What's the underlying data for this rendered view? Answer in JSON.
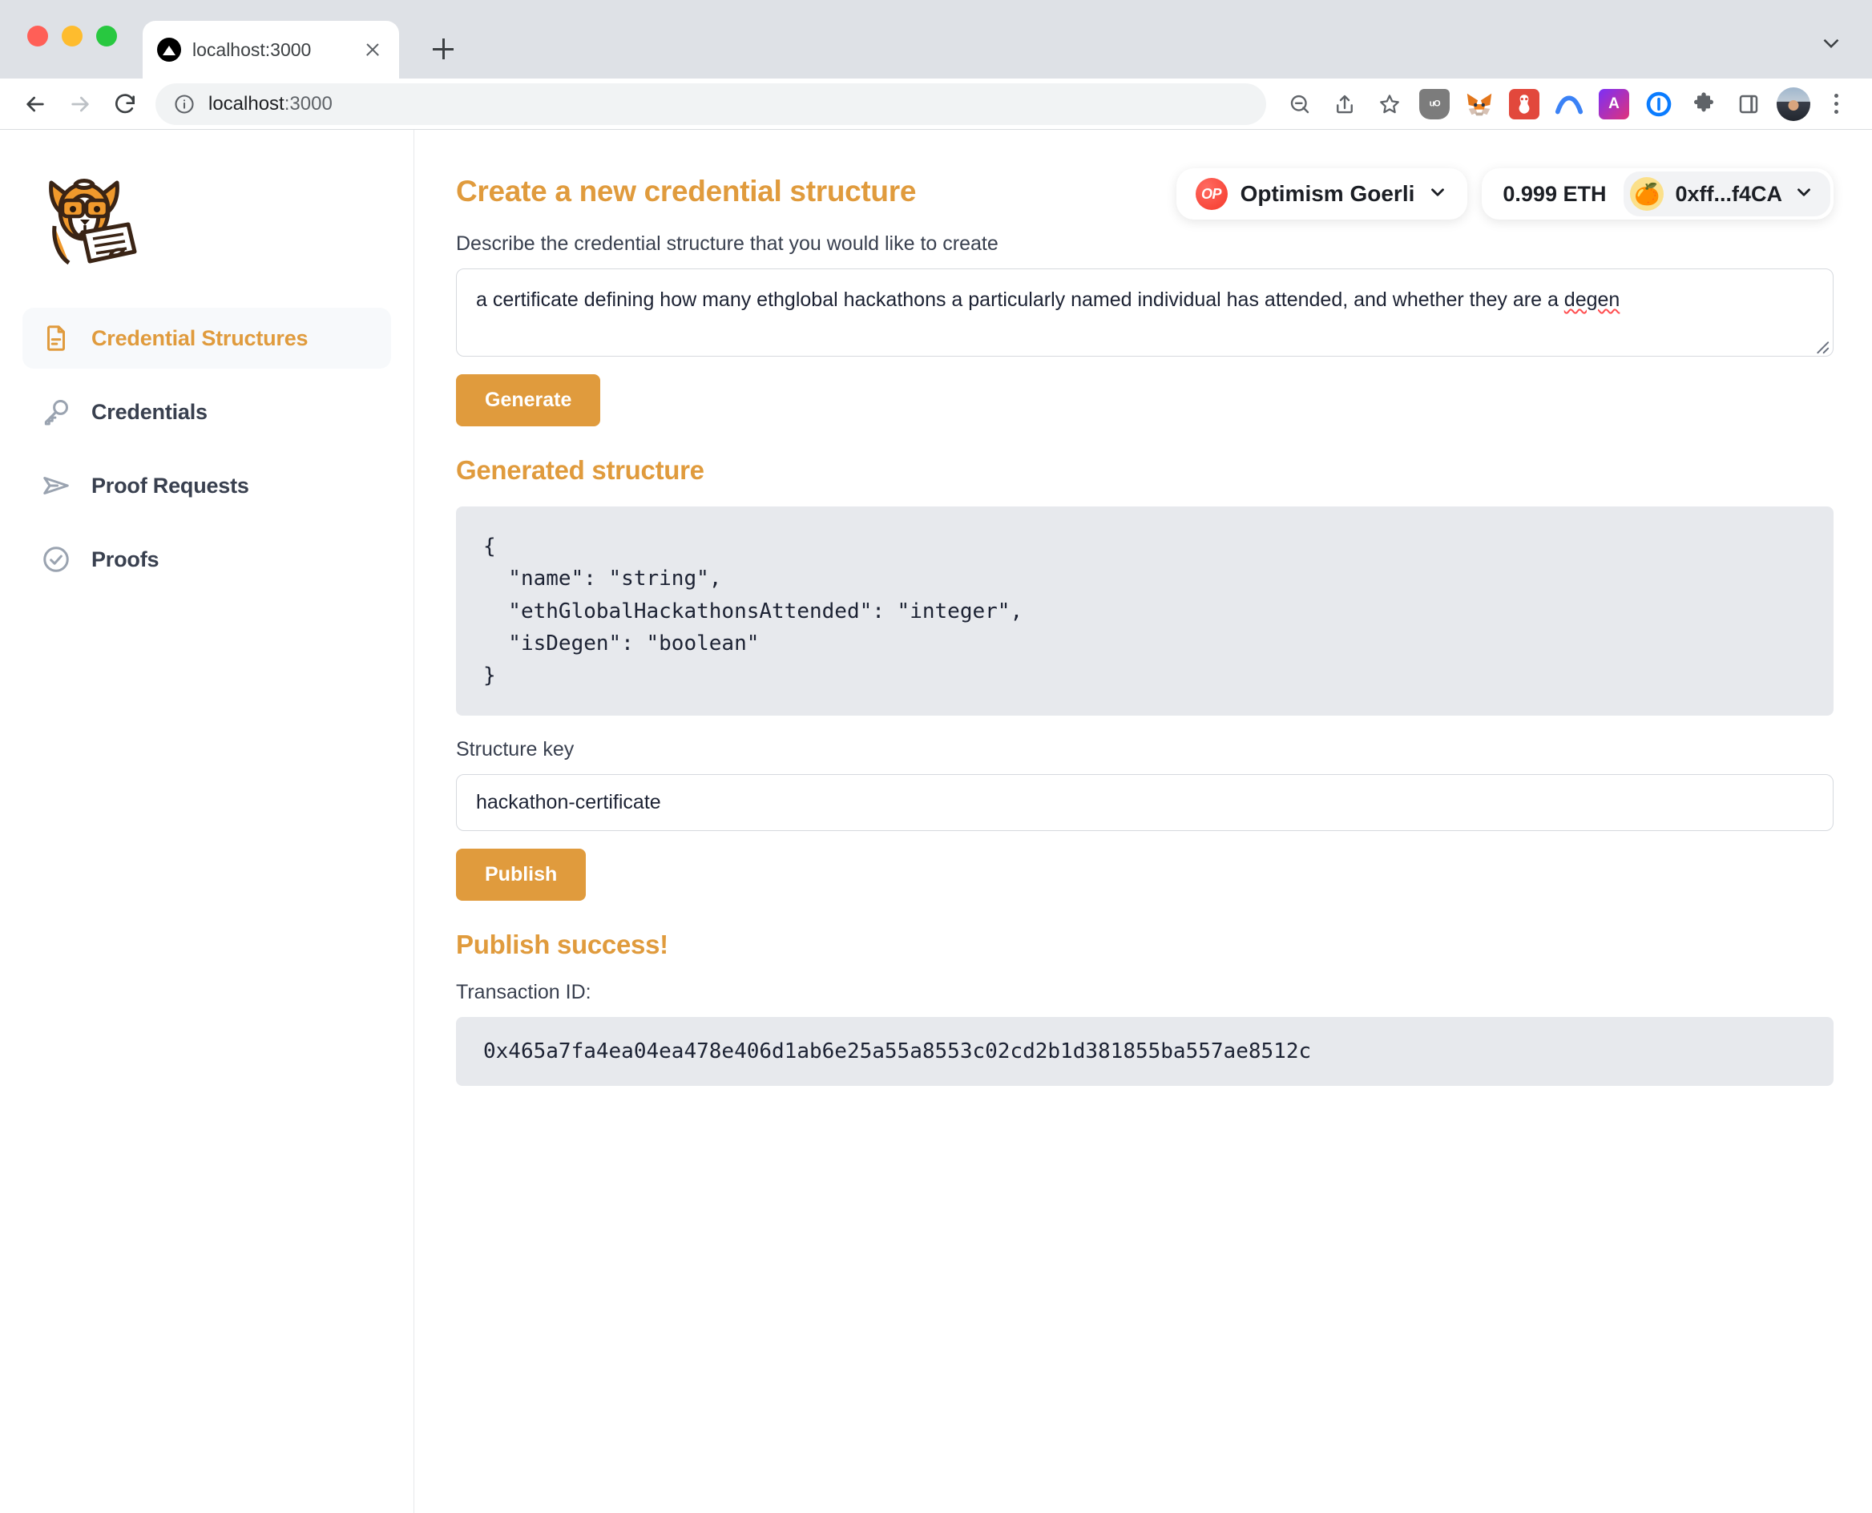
{
  "browser": {
    "tab": {
      "title": "localhost:3000",
      "favicon": "vercel-triangle-icon"
    },
    "omnibox": {
      "host": "localhost",
      "port": ":3000",
      "info_icon": "info-circle-icon"
    },
    "nav": {
      "back": "back-arrow-icon",
      "forward": "forward-arrow-icon",
      "reload": "reload-icon"
    },
    "actions": {
      "zoom_out": "zoom-out-icon",
      "share": "share-icon",
      "bookmark": "star-icon",
      "extensions": "puzzle-icon",
      "side_panel": "side-panel-icon",
      "menu": "kebab-menu-icon"
    },
    "extensions": [
      {
        "name": "ublock-origin-extension-icon",
        "label": "uO"
      },
      {
        "name": "metamask-extension-icon",
        "label": ""
      },
      {
        "name": "rabby-wallet-extension-icon",
        "label": ""
      },
      {
        "name": "arc-extension-icon",
        "label": ""
      },
      {
        "name": "a-extension-icon",
        "label": "A"
      },
      {
        "name": "onepassword-extension-icon",
        "label": ""
      }
    ]
  },
  "sidebar": {
    "logo_alt": "corgi-reading-document-logo",
    "items": [
      {
        "label": "Credential Structures",
        "icon": "document-icon",
        "active": true
      },
      {
        "label": "Credentials",
        "icon": "key-icon",
        "active": false
      },
      {
        "label": "Proof Requests",
        "icon": "paper-plane-icon",
        "active": false
      },
      {
        "label": "Proofs",
        "icon": "check-circle-icon",
        "active": false
      }
    ]
  },
  "wallet": {
    "chain": {
      "badge": "OP",
      "name": "Optimism Goerli",
      "chevron": "chevron-down-icon"
    },
    "balance": "0.999 ETH",
    "address": "0xff...f4CA",
    "avatar": "🍊",
    "chevron": "chevron-down-icon"
  },
  "main": {
    "page_title": "Create a new credential structure",
    "describe_label": "Describe the credential structure that you would like to create",
    "description_value_pre": "a certificate defining how many ethglobal hackathons a particularly named individual has attended, and whether they are a ",
    "description_value_misspelled": "degen",
    "description_placeholder": "",
    "generate_label": "Generate",
    "generated_heading": "Generated structure",
    "generated_structure": "{\n  \"name\": \"string\",\n  \"ethGlobalHackathonsAttended\": \"integer\",\n  \"isDegen\": \"boolean\"\n}",
    "structure_key_label": "Structure key",
    "structure_key_value": "hackathon-certificate",
    "structure_key_placeholder": "",
    "publish_label": "Publish",
    "publish_success_heading": "Publish success!",
    "transaction_id_label": "Transaction ID:",
    "transaction_id_value": "0x465a7fa4ea04ea478e406d1ab6e25a55a8553c02cd2b1d381855ba557ae8512c"
  },
  "colors": {
    "accent": "#e09b3d",
    "text": "#39404f",
    "code_bg": "#e7e9ed",
    "active_nav_bg": "#f7f9fb",
    "op_red": "#f5392b"
  }
}
